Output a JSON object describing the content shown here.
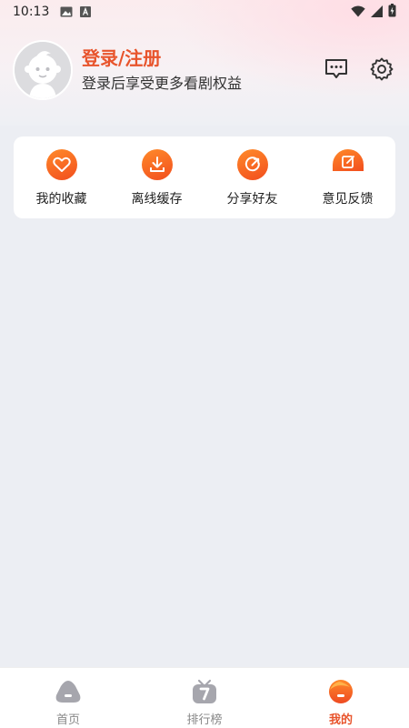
{
  "status_bar": {
    "time": "10:13"
  },
  "profile": {
    "title": "登录/注册",
    "subtitle": "登录后享受更多看剧权益"
  },
  "actions": [
    {
      "label": "我的收藏",
      "icon": "heart-icon"
    },
    {
      "label": "离线缓存",
      "icon": "download-icon"
    },
    {
      "label": "分享好友",
      "icon": "share-icon"
    },
    {
      "label": "意见反馈",
      "icon": "feedback-icon"
    }
  ],
  "nav": [
    {
      "label": "首页",
      "icon": "home-icon"
    },
    {
      "label": "排行榜",
      "icon": "ranking-icon"
    },
    {
      "label": "我的",
      "icon": "profile-icon"
    }
  ],
  "colors": {
    "accent": "#e8542c",
    "background": "#eceef3"
  }
}
